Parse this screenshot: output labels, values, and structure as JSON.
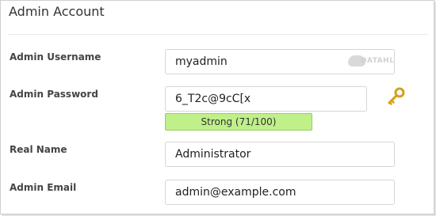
{
  "panel": {
    "title": "Admin Account"
  },
  "fields": {
    "username": {
      "label": "Admin Username",
      "value": "myadmin"
    },
    "password": {
      "label": "Admin Password",
      "value": "6_T2c@9cC[x",
      "strength_text": "Strong (71/100)",
      "strength_color": "#c0f08a"
    },
    "realname": {
      "label": "Real Name",
      "value": "Administrator"
    },
    "email": {
      "label": "Admin Email",
      "value": "admin@example.com"
    }
  },
  "icons": {
    "generate_password": "key-icon",
    "brand": "cloud-icon"
  },
  "watermark": {
    "text": "DATAHL"
  }
}
